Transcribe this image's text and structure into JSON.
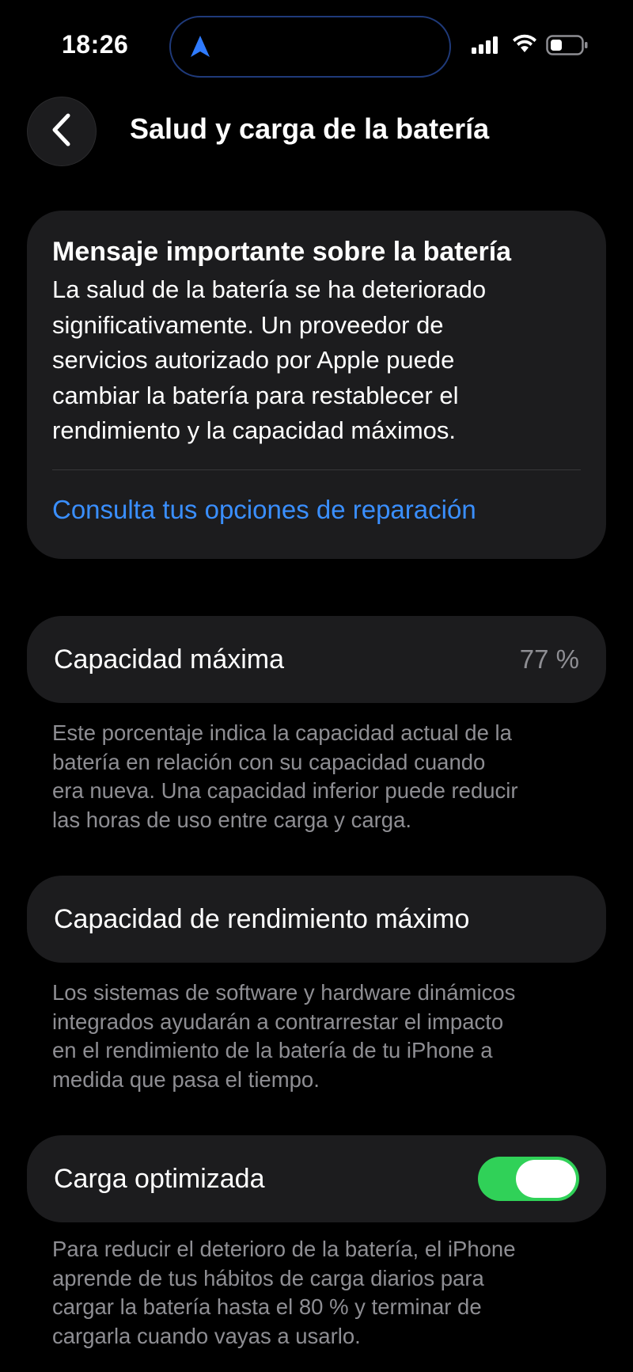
{
  "status_bar": {
    "time": "18:26"
  },
  "nav": {
    "title": "Salud y carga de la batería"
  },
  "message": {
    "title": "Mensaje importante sobre la batería",
    "lines": [
      "La salud de la batería se ha deteriorado",
      "significativamente. Un proveedor de",
      "servicios autorizado por Apple puede",
      "cambiar la batería para restablecer el",
      "rendimiento y la capacidad máximos."
    ],
    "link": "Consulta tus opciones de reparación"
  },
  "max_capacity": {
    "label": "Capacidad máxima",
    "value": "77 %",
    "footnote_lines": [
      "Este porcentaje indica la capacidad actual de la",
      "batería en relación con su capacidad cuando",
      "era nueva. Una capacidad inferior puede reducir",
      "las horas de uso entre carga y carga."
    ]
  },
  "peak_performance": {
    "label": "Capacidad de rendimiento máximo",
    "footnote_lines": [
      "Los sistemas de software y hardware dinámicos",
      "integrados ayudarán a contrarrestar el impacto",
      "en el rendimiento de la batería de tu iPhone a",
      "medida que pasa el tiempo."
    ]
  },
  "optimized_charging": {
    "label": "Carga optimizada",
    "enabled": true,
    "footnote_lines": [
      "Para reducir el deterioro de la batería, el iPhone",
      "aprende de tus hábitos de carga diarios para",
      "cargar la batería hasta el 80 % y terminar de",
      "cargarla cuando vayas a usarlo."
    ]
  },
  "colors": {
    "background": "#000000",
    "card": "#1c1c1e",
    "link": "#3a8fff",
    "secondary_text": "#8e8e93",
    "toggle_on": "#30d158"
  },
  "icons": {
    "location": "location-arrow-icon",
    "signal": "cellular-signal-icon",
    "wifi": "wifi-icon",
    "battery": "battery-icon",
    "back": "chevron-left-icon"
  }
}
